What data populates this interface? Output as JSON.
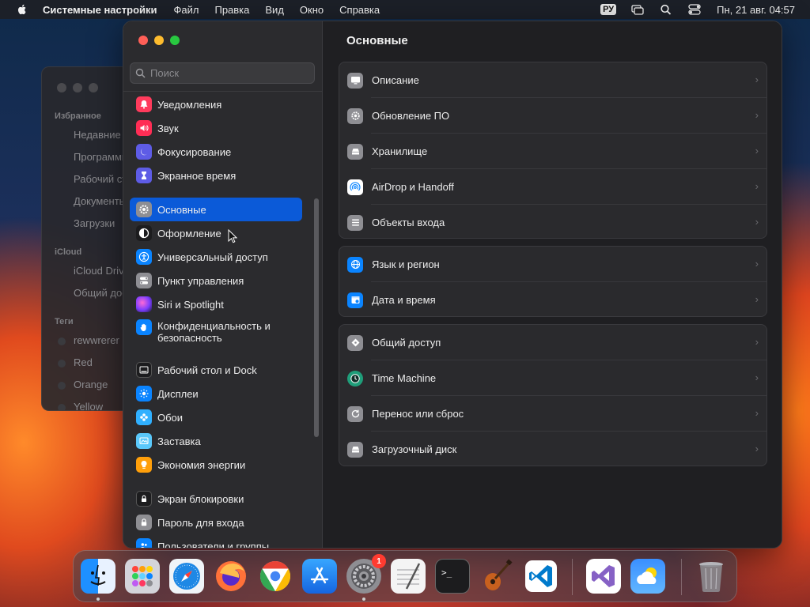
{
  "menubar": {
    "app_name": "Системные настройки",
    "items": [
      "Файл",
      "Правка",
      "Вид",
      "Окно",
      "Справка"
    ],
    "keyboard_layout": "РУ",
    "clock": "Пн, 21 авг.  04:57"
  },
  "finder": {
    "sections": [
      "Избранное",
      "iCloud",
      "Теги"
    ],
    "favorites": [
      "Недавние",
      "Программы",
      "Рабочий стол",
      "Документы",
      "Загрузки"
    ],
    "icloud": [
      "iCloud Drive",
      "Общий доступ"
    ],
    "tags": [
      "rewwrerer",
      "Red",
      "Orange",
      "Yellow"
    ],
    "tag_colors": [
      "#3a3a3e",
      "#3a3a3e",
      "#3a3a3e",
      "#3a3a3e"
    ]
  },
  "sidebar": {
    "search_placeholder": "Поиск",
    "items": [
      {
        "label": "Уведомления",
        "icon": "bell-icon",
        "color": "#ff3b5c"
      },
      {
        "label": "Звук",
        "icon": "speaker-icon",
        "color": "#ff2d55"
      },
      {
        "label": "Фокусирование",
        "icon": "moon-icon",
        "color": "#5e5ce6"
      },
      {
        "label": "Экранное время",
        "icon": "hourglass-icon",
        "color": "#5e5ce6"
      },
      {
        "label": "Основные",
        "icon": "gear-icon",
        "color": "#8e8e93"
      },
      {
        "label": "Оформление",
        "icon": "appearance-icon",
        "color": "#1c1c1e"
      },
      {
        "label": "Универсальный доступ",
        "icon": "accessibility-icon",
        "color": "#0a84ff"
      },
      {
        "label": "Пункт управления",
        "icon": "toggles-icon",
        "color": "#8e8e93"
      },
      {
        "label": "Siri и Spotlight",
        "icon": "siri-icon",
        "color": "#bf5af2"
      },
      {
        "label": "Конфиденциальность и безопасность",
        "icon": "hand-icon",
        "color": "#0a84ff"
      },
      {
        "label": "Рабочий стол и Dock",
        "icon": "dock-icon",
        "color": "#1c1c1e"
      },
      {
        "label": "Дисплеи",
        "icon": "sun-icon",
        "color": "#0a84ff"
      },
      {
        "label": "Обои",
        "icon": "flower-icon",
        "color": "#30b0ff"
      },
      {
        "label": "Заставка",
        "icon": "screensaver-icon",
        "color": "#5ac8fa"
      },
      {
        "label": "Экономия энергии",
        "icon": "bulb-icon",
        "color": "#ff9f0a"
      },
      {
        "label": "Экран блокировки",
        "icon": "lock-screen-icon",
        "color": "#1c1c1e"
      },
      {
        "label": "Пароль для входа",
        "icon": "lock-icon",
        "color": "#8e8e93"
      },
      {
        "label": "Пользователи и группы",
        "icon": "users-icon",
        "color": "#0a84ff"
      }
    ]
  },
  "content": {
    "title": "Основные",
    "groups": [
      [
        {
          "label": "Описание",
          "icon": "display-icon",
          "color": "#8e8e93"
        },
        {
          "label": "Обновление ПО",
          "icon": "gear-badge-icon",
          "color": "#8e8e93"
        },
        {
          "label": "Хранилище",
          "icon": "drive-icon",
          "color": "#8e8e93"
        },
        {
          "label": "AirDrop и Handoff",
          "icon": "airdrop-icon",
          "color": "#ffffff"
        },
        {
          "label": "Объекты входа",
          "icon": "list-icon",
          "color": "#8e8e93"
        }
      ],
      [
        {
          "label": "Язык и регион",
          "icon": "globe-icon",
          "color": "#0a84ff"
        },
        {
          "label": "Дата и время",
          "icon": "calendar-clock-icon",
          "color": "#0a84ff"
        }
      ],
      [
        {
          "label": "Общий доступ",
          "icon": "sharing-icon",
          "color": "#8e8e93"
        },
        {
          "label": "Time Machine",
          "icon": "time-machine-icon",
          "color": "#1f9e7a"
        },
        {
          "label": "Перенос или сброс",
          "icon": "reset-icon",
          "color": "#8e8e93"
        },
        {
          "label": "Загрузочный диск",
          "icon": "startup-disk-icon",
          "color": "#8e8e93"
        }
      ]
    ]
  },
  "dock": {
    "apps": [
      {
        "name": "finder",
        "icon": "finder-icon",
        "color": "#1e90ff",
        "running": true
      },
      {
        "name": "launchpad",
        "icon": "launchpad-icon",
        "color": "#c9c9cf",
        "running": false
      },
      {
        "name": "safari",
        "icon": "safari-icon",
        "color": "#1e88e5",
        "running": false
      },
      {
        "name": "firefox",
        "icon": "firefox-icon",
        "color": "#ff7139",
        "running": false
      },
      {
        "name": "chrome",
        "icon": "chrome-icon",
        "color": "#ffffff",
        "running": false
      },
      {
        "name": "app-store",
        "icon": "app-store-icon",
        "color": "#1e88ff",
        "running": false
      },
      {
        "name": "system-settings",
        "icon": "system-settings-icon",
        "color": "#8e8e93",
        "running": true,
        "badge": "1"
      },
      {
        "name": "textedit",
        "icon": "textedit-icon",
        "color": "#f2f2f2",
        "running": false
      },
      {
        "name": "terminal",
        "icon": "terminal-icon",
        "color": "#1c1c1e",
        "running": false
      },
      {
        "name": "garageband",
        "icon": "guitar-icon",
        "color": "#2b2b2e",
        "running": false
      },
      {
        "name": "vscode",
        "icon": "vscode-icon",
        "color": "#ffffff",
        "running": false
      },
      {
        "name": "visual-studio",
        "icon": "visual-studio-icon",
        "color": "#ffffff",
        "running": false
      },
      {
        "name": "weather",
        "icon": "weather-icon",
        "color": "#2e8bff",
        "running": false
      },
      {
        "name": "trash",
        "icon": "trash-icon",
        "color": "#9a9a9e",
        "running": false
      }
    ]
  }
}
